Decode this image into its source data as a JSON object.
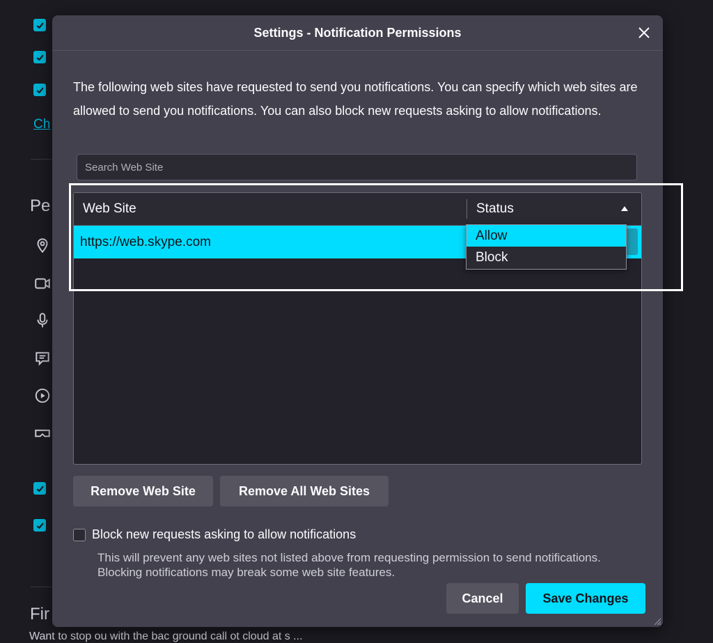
{
  "dialog": {
    "title": "Settings - Notification Permissions",
    "description": "The following web sites have requested to send you notifications. You can specify which web sites are allowed to send you notifications. You can also block new requests asking to allow notifications.",
    "search_placeholder": "Search Web Site",
    "table": {
      "columns": [
        "Web Site",
        "Status"
      ],
      "rows": [
        {
          "site": "https://web.skype.com"
        }
      ]
    },
    "status_dropdown": {
      "options": [
        "Allow",
        "Block"
      ],
      "selected": "Allow"
    },
    "buttons": {
      "remove": "Remove Web Site",
      "remove_all": "Remove All Web Sites",
      "cancel": "Cancel",
      "save": "Save Changes"
    },
    "block_checkbox": {
      "label": "Block new requests asking to allow notifications",
      "checked": false,
      "description": "This will prevent any web sites not listed above from requesting permission to send notifications. Blocking notifications may break some web site features."
    }
  },
  "background": {
    "link_text": "Ch",
    "heading_1": "Pe",
    "heading_2": "Fir",
    "footer_text": "Want to stop ou  with the bac  ground  call  ot  cloud at  s  ..."
  },
  "colors": {
    "accent": "#00ddff",
    "dialog_bg": "#42414d",
    "page_bg": "#1c1b22",
    "checkbox_accent": "#00b3d4"
  }
}
